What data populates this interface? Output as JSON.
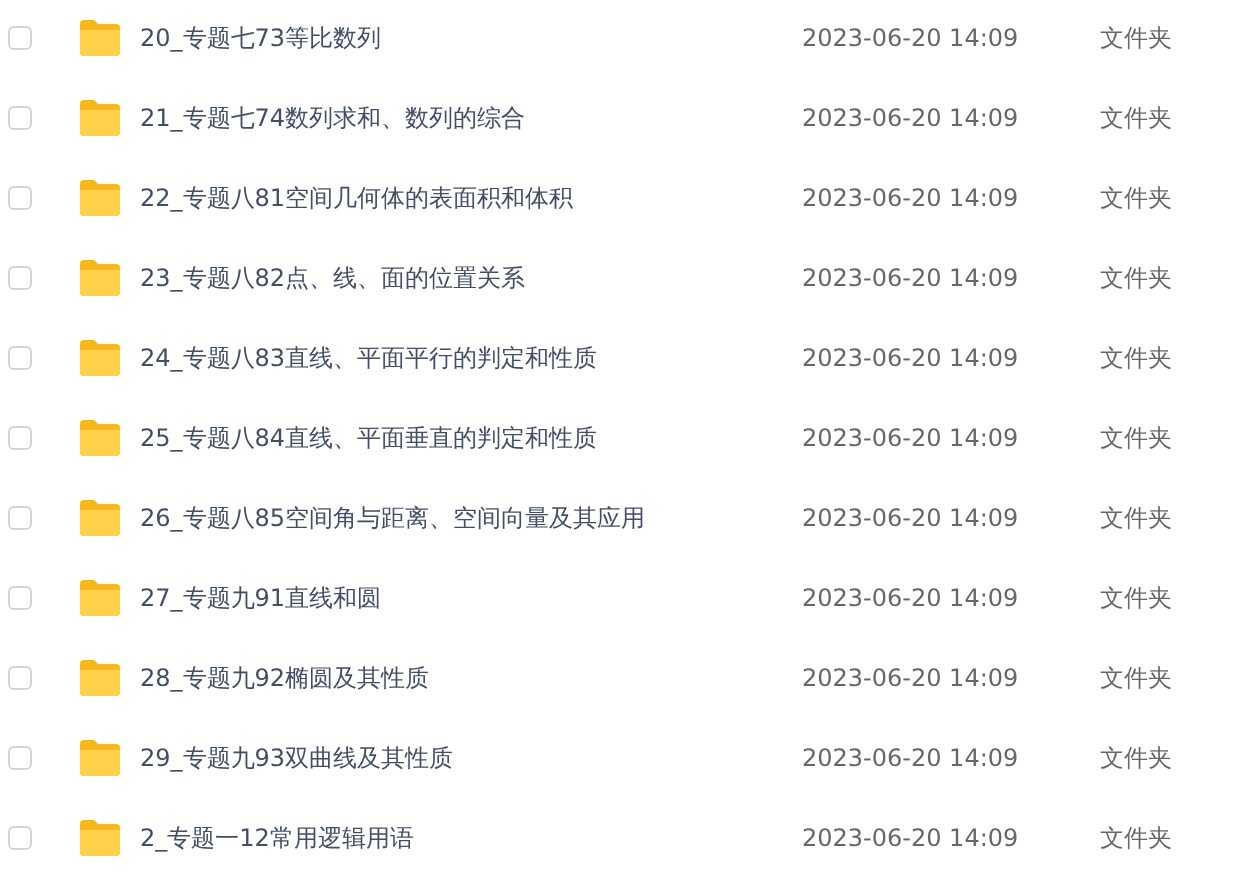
{
  "files": [
    {
      "name": "20_专题七73等比数列",
      "modified": "2023-06-20 14:09",
      "type": "文件夹",
      "checked": false
    },
    {
      "name": "21_专题七74数列求和、数列的综合",
      "modified": "2023-06-20 14:09",
      "type": "文件夹",
      "checked": false
    },
    {
      "name": "22_专题八81空间几何体的表面积和体积",
      "modified": "2023-06-20 14:09",
      "type": "文件夹",
      "checked": false
    },
    {
      "name": "23_专题八82点、线、面的位置关系",
      "modified": "2023-06-20 14:09",
      "type": "文件夹",
      "checked": false
    },
    {
      "name": "24_专题八83直线、平面平行的判定和性质",
      "modified": "2023-06-20 14:09",
      "type": "文件夹",
      "checked": false
    },
    {
      "name": "25_专题八84直线、平面垂直的判定和性质",
      "modified": "2023-06-20 14:09",
      "type": "文件夹",
      "checked": false
    },
    {
      "name": "26_专题八85空间角与距离、空间向量及其应用",
      "modified": "2023-06-20 14:09",
      "type": "文件夹",
      "checked": false
    },
    {
      "name": "27_专题九91直线和圆",
      "modified": "2023-06-20 14:09",
      "type": "文件夹",
      "checked": false
    },
    {
      "name": "28_专题九92椭圆及其性质",
      "modified": "2023-06-20 14:09",
      "type": "文件夹",
      "checked": false
    },
    {
      "name": "29_专题九93双曲线及其性质",
      "modified": "2023-06-20 14:09",
      "type": "文件夹",
      "checked": false
    },
    {
      "name": "2_专题一12常用逻辑用语",
      "modified": "2023-06-20 14:09",
      "type": "文件夹",
      "checked": false
    }
  ]
}
